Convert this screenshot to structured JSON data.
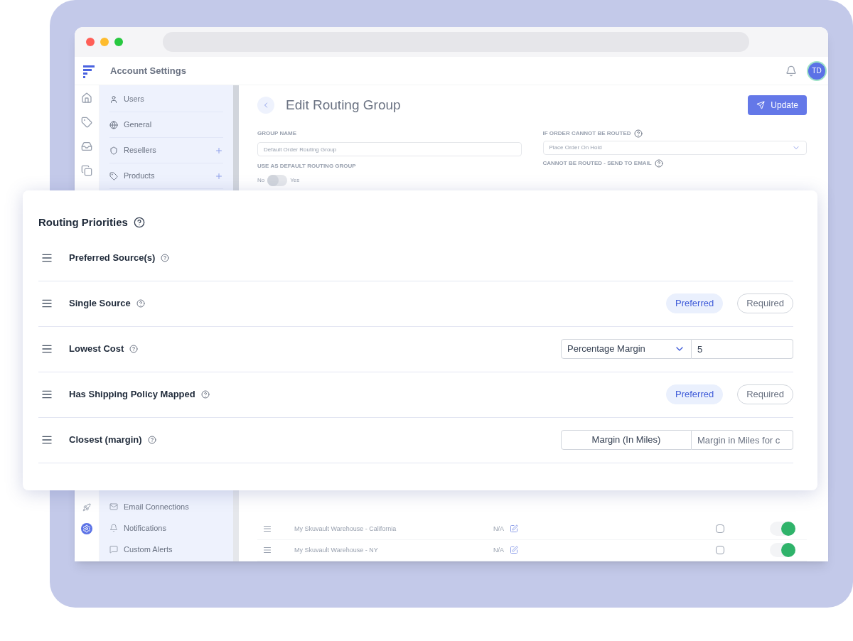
{
  "app_header": {
    "title": "Account Settings",
    "avatar": "TD"
  },
  "sidebar": {
    "top_items": [
      {
        "label": "Users",
        "expandable": false
      },
      {
        "label": "General",
        "expandable": false
      },
      {
        "label": "Resellers",
        "expandable": true
      },
      {
        "label": "Products",
        "expandable": true
      }
    ],
    "bottom_items": [
      {
        "label": "Email Connections"
      },
      {
        "label": "Notifications"
      },
      {
        "label": "Custom Alerts"
      }
    ]
  },
  "rail": {
    "top": [
      {
        "selected": false
      },
      {
        "selected": false
      },
      {
        "selected": false
      },
      {
        "selected": false
      }
    ],
    "bottom": [
      {
        "selected": false
      },
      {
        "selected": true
      }
    ]
  },
  "page": {
    "title": "Edit Routing Group",
    "update_button": "Update",
    "group_name": {
      "label": "GROUP NAME",
      "value": "Default Order Routing Group"
    },
    "cannot_route": {
      "label": "IF ORDER CANNOT BE ROUTED",
      "value": "Place Order On Hold"
    },
    "default_group": {
      "label": "USE AS DEFAULT ROUTING GROUP",
      "off_label": "No",
      "on_label": "Yes",
      "on": false
    },
    "send_email": {
      "label": "CANNOT BE ROUTED - SEND TO EMAIL"
    }
  },
  "sources": [
    {
      "name": "My Skuvault Warehouse - California",
      "value": "N/A",
      "checked": false,
      "on": true
    },
    {
      "name": "My Skuvault Warehouse - NY",
      "value": "N/A",
      "checked": false,
      "on": true
    }
  ],
  "routing_priorities": {
    "title": "Routing Priorities",
    "rows": [
      {
        "kind": "plain",
        "label": "Preferred Source(s)"
      },
      {
        "kind": "choice",
        "label": "Single Source",
        "options": [
          {
            "label": "Preferred",
            "selected": true
          },
          {
            "label": "Required",
            "selected": false
          }
        ]
      },
      {
        "kind": "select_input",
        "label": "Lowest Cost",
        "select": "Percentage Margin",
        "value": "5"
      },
      {
        "kind": "choice",
        "label": "Has Shipping Policy Mapped",
        "options": [
          {
            "label": "Preferred",
            "selected": true
          },
          {
            "label": "Required",
            "selected": false
          }
        ]
      },
      {
        "kind": "label_input",
        "label": "Closest (margin)",
        "addon": "Margin (In Miles)",
        "placeholder": "Margin in Miles for c"
      }
    ]
  }
}
